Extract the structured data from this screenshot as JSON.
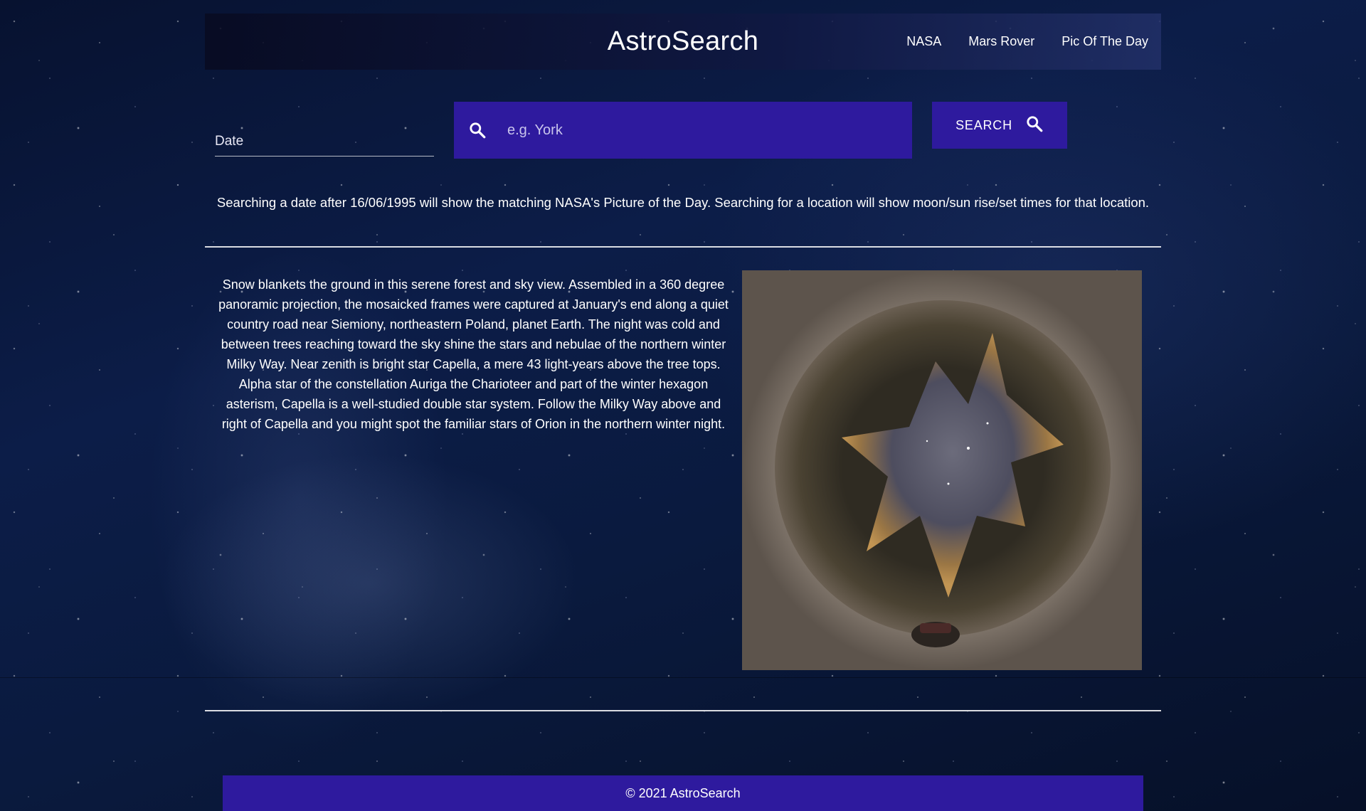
{
  "header": {
    "brand": "AstroSearch",
    "nav": [
      "NASA",
      "Mars Rover",
      "Pic Of The Day"
    ]
  },
  "search": {
    "date_placeholder": "Date",
    "location_placeholder": "e.g. York",
    "button_label": "SEARCH"
  },
  "info_text": "Searching a date after 16/06/1995 will show the matching NASA's Picture of the Day. Searching for a location will show moon/sun rise/set times for that location.",
  "apod": {
    "description": "Snow blankets the ground in this serene forest and sky view. Assembled in a 360 degree panoramic projection, the mosaicked frames were captured at January's end along a quiet country road near Siemiony, northeastern Poland, planet Earth. The night was cold and between trees reaching toward the sky shine the stars and nebulae of the northern winter Milky Way. Near zenith is bright star Capella, a mere 43 light-years above the tree tops. Alpha star of the constellation Auriga the Charioteer and part of the winter hexagon asterism, Capella is a well-studied double star system. Follow the Milky Way above and right of Capella and you might spot the familiar stars of Orion in the northern winter night."
  },
  "footer": {
    "text": "© 2021 AstroSearch"
  },
  "colors": {
    "accent": "#2e1a9e",
    "background": "#0c1d48"
  }
}
